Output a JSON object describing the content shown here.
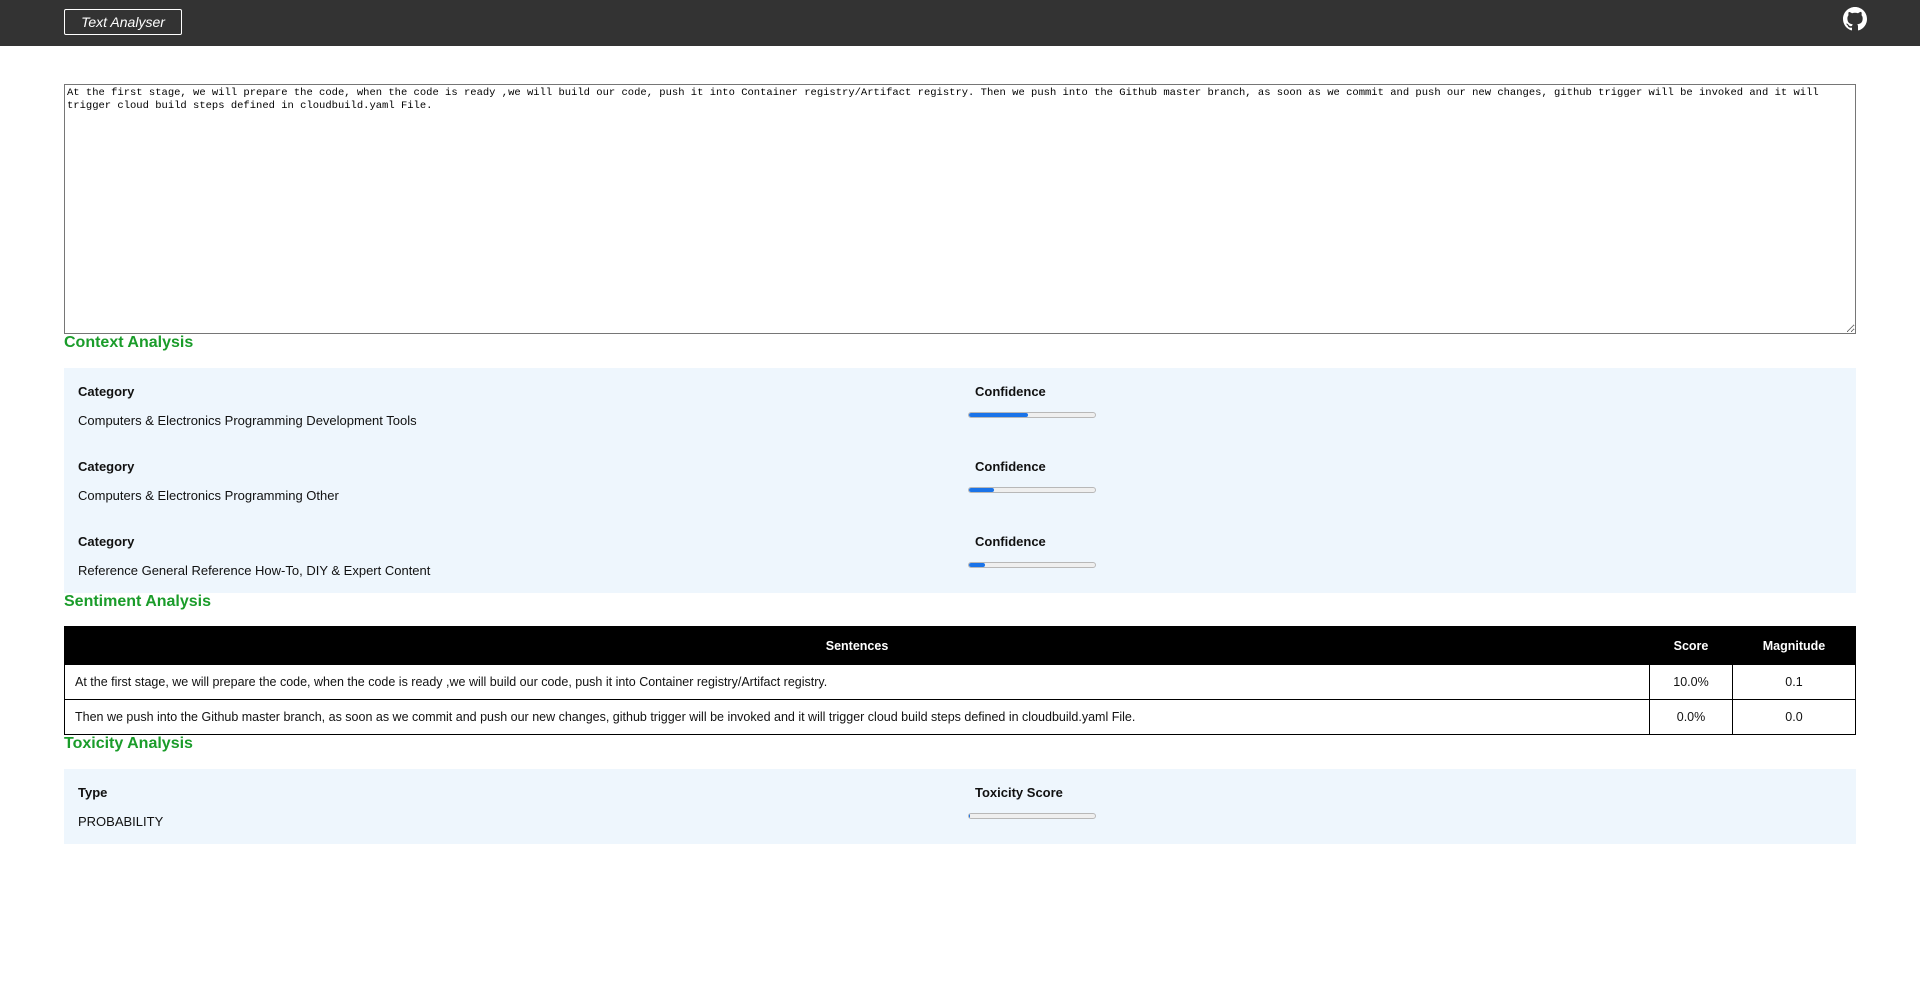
{
  "header": {
    "brand": "Text Analyser",
    "github_icon": "github-icon"
  },
  "input": {
    "text": "At the first stage, we will prepare the code, when the code is ready ,we will build our code, push it into Container registry/Artifact registry. Then we push into the Github master branch, as soon as we commit and push our new changes, github trigger will be invoked and it will trigger cloud build steps defined in cloudbuild.yaml File."
  },
  "context": {
    "title": "Context Analysis",
    "rows": [
      {
        "category_label": "Category",
        "category": "Computers & Electronics Programming Development Tools",
        "confidence_label": "Confidence",
        "confidence": 0.47
      },
      {
        "category_label": "Category",
        "category": "Computers & Electronics Programming Other",
        "confidence_label": "Confidence",
        "confidence": 0.2
      },
      {
        "category_label": "Category",
        "category": "Reference General Reference How-To, DIY & Expert Content",
        "confidence_label": "Confidence",
        "confidence": 0.13
      }
    ]
  },
  "sentiment": {
    "title": "Sentiment Analysis",
    "headers": {
      "sentences": "Sentences",
      "score": "Score",
      "magnitude": "Magnitude"
    },
    "rows": [
      {
        "sentence": "At the first stage, we will prepare the code, when the code is ready ,we will build our code, push it into Container registry/Artifact registry.",
        "score": "10.0%",
        "magnitude": "0.1"
      },
      {
        "sentence": "Then we push into the Github master branch, as soon as we commit and push our new changes, github trigger will be invoked and it will trigger cloud build steps defined in cloudbuild.yaml File.",
        "score": "0.0%",
        "magnitude": "0.0"
      }
    ]
  },
  "toxicity": {
    "title": "Toxicity Analysis",
    "type_label": "Type",
    "type": "PROBABILITY",
    "score_label": "Toxicity Score",
    "score": 0.01
  },
  "colors": {
    "topbar": "#333333",
    "section_title": "#1a9c2a",
    "panel_bg": "#eef6fd",
    "bar_fill": "#1a73e8",
    "table_header": "#000000"
  }
}
